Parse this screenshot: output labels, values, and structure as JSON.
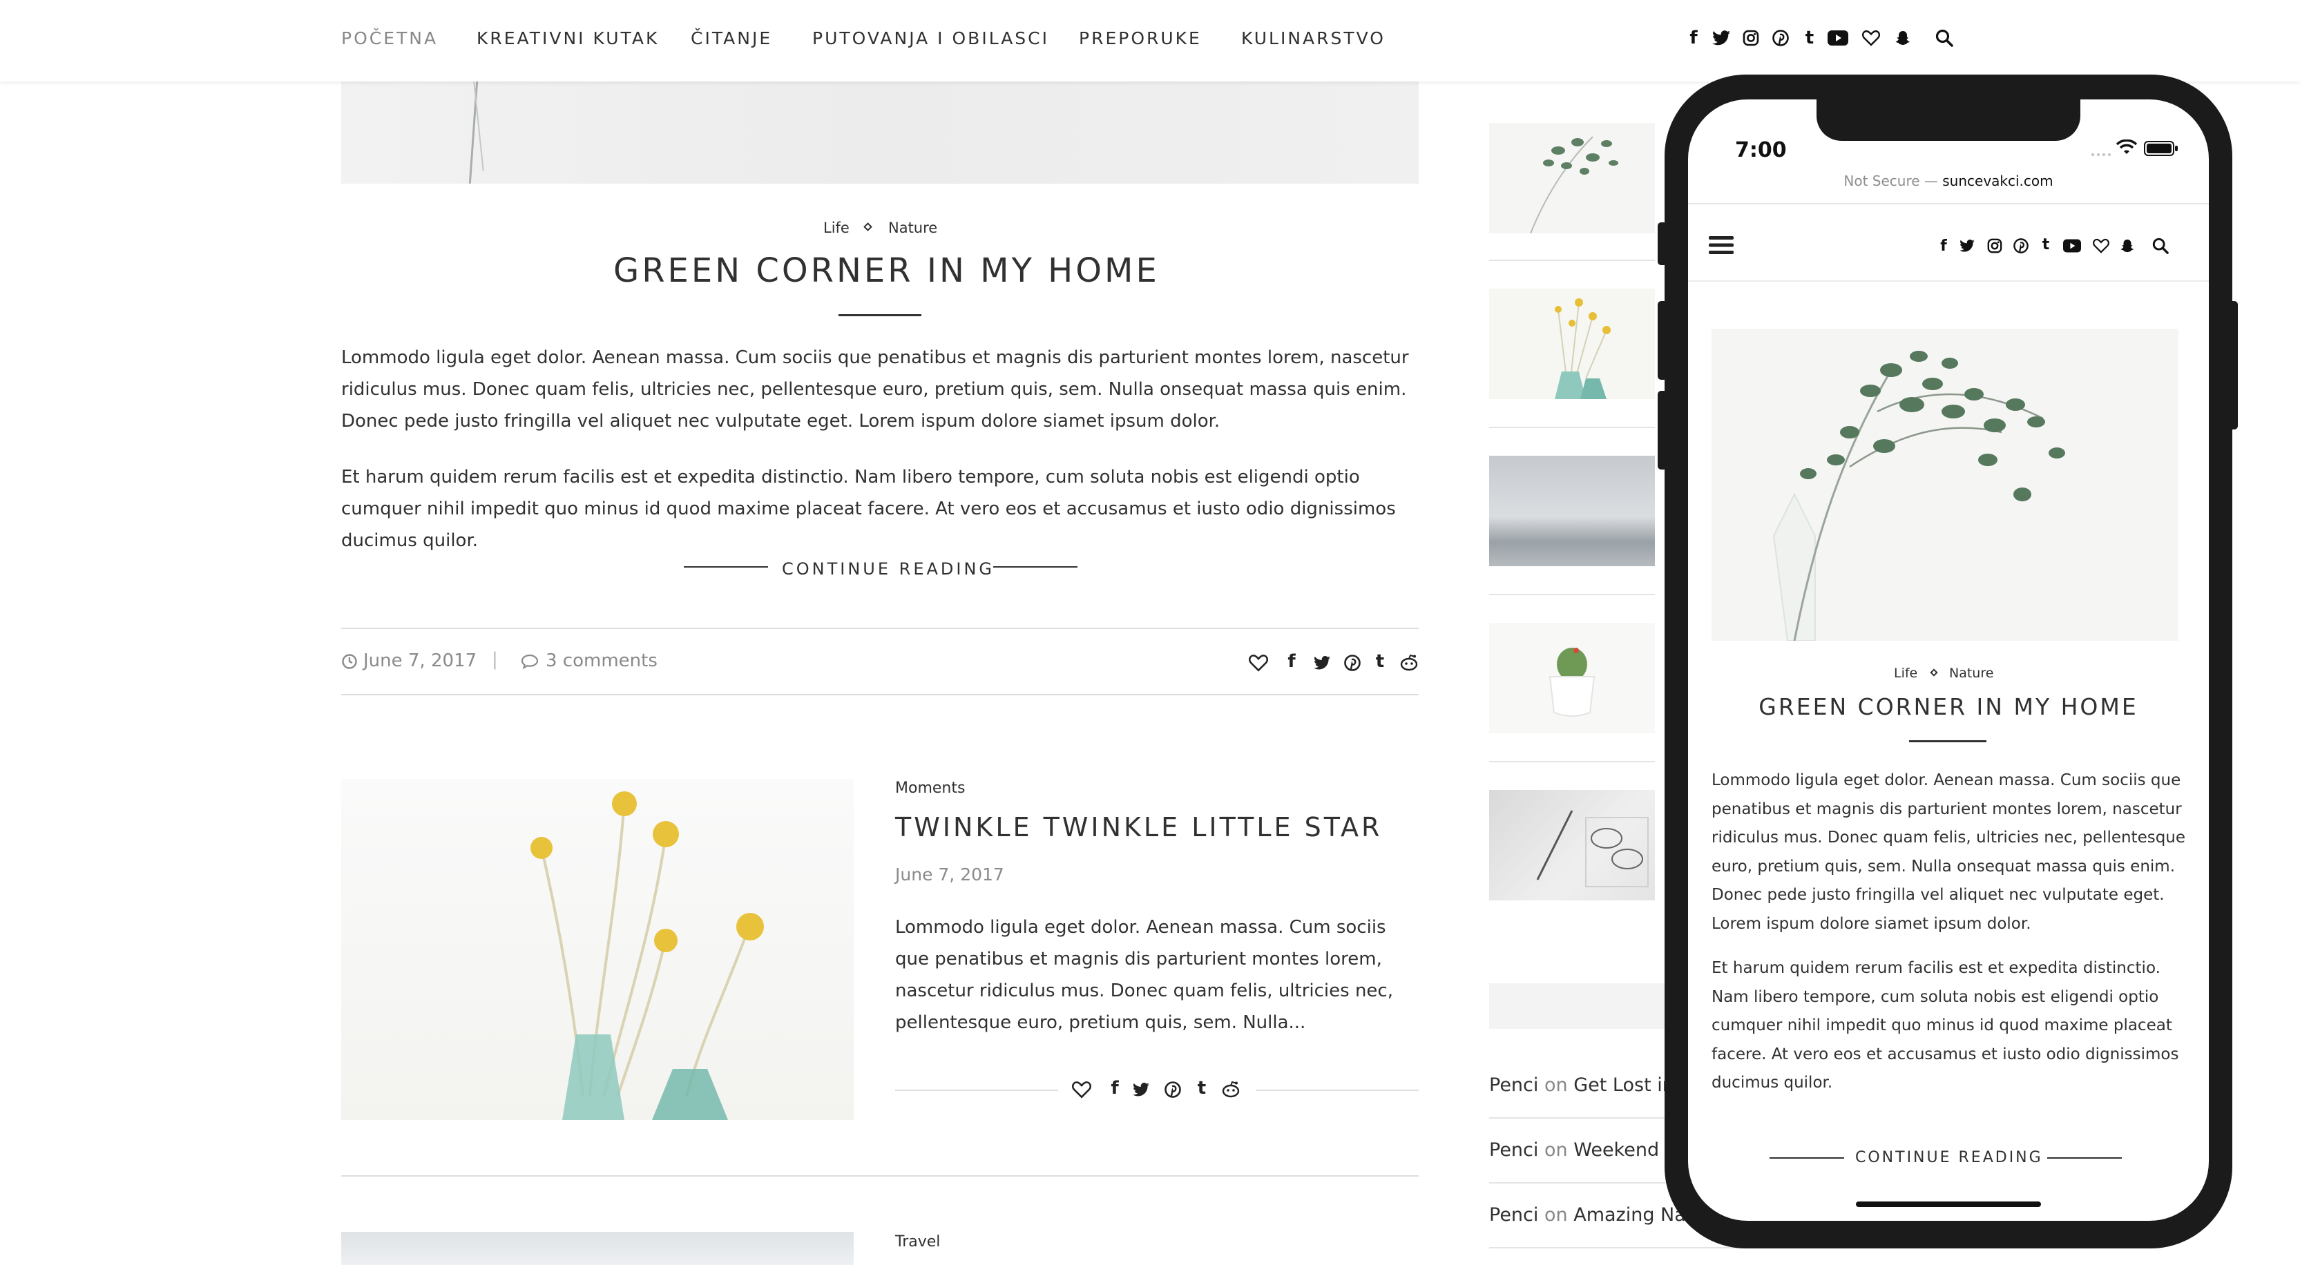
{
  "nav": {
    "items": [
      "POČETNA",
      "KREATIVNI KUTAK",
      "ČITANJE",
      "PUTOVANJA I OBILASCI",
      "PREPORUKE",
      "KULINARSTVO"
    ]
  },
  "social_icons": [
    "facebook-icon",
    "twitter-icon",
    "instagram-icon",
    "pinterest-icon",
    "tumblr-icon",
    "youtube-icon",
    "heart-icon",
    "snapchat-icon"
  ],
  "post1": {
    "categories": [
      "Life",
      "Nature"
    ],
    "title": "GREEN CORNER IN MY HOME",
    "paragraph1": "Lommodo ligula eget dolor. Aenean massa. Cum sociis que penatibus et magnis dis parturient montes lorem, nascetur ridiculus mus. Donec quam felis, ultricies nec, pellentesque euro, pretium quis, sem. Nulla onsequat massa quis enim. Donec pede justo fringilla vel aliquet nec vulputate eget. Lorem ispum dolore siamet ipsum dolor.",
    "paragraph2": "Et harum quidem rerum facilis est et expedita distinctio. Nam libero tempore, cum soluta nobis est eligendi optio cumquer nihil impedit quo minus id quod maxime placeat facere. At vero eos et accusamus et iusto odio dignissimos ducimus quilor.",
    "continue": "CONTINUE READING",
    "date": "June 7, 2017",
    "separator": "|",
    "comments": "3 comments"
  },
  "post2": {
    "category": "Moments",
    "title": "TWINKLE TWINKLE LITTLE STAR",
    "date": "June 7, 2017",
    "excerpt": "Lommodo ligula eget dolor. Aenean massa. Cum sociis que penatibus et magnis dis parturient montes lorem, nascetur ridiculus mus. Donec quam felis, ultricies nec, pellentesque euro, pretium quis, sem. Nulla..."
  },
  "post3": {
    "category": "Travel"
  },
  "sidebar": {
    "comments": [
      {
        "author": "Penci",
        "on": "on",
        "post": "Get Lost in t"
      },
      {
        "author": "Penci",
        "on": "on",
        "post": "Weekend Co"
      },
      {
        "author": "Penci",
        "on": "on",
        "post": "Amazing Natu"
      }
    ]
  },
  "phone": {
    "time": "7:00",
    "url_prefix": "Not Secure —",
    "url_domain": "suncevakci.com",
    "categories": [
      "Life",
      "Nature"
    ],
    "title": "GREEN CORNER IN MY HOME",
    "paragraph1": "Lommodo ligula eget dolor. Aenean massa. Cum sociis que penatibus et magnis dis parturient montes lorem, nascetur ridiculus mus. Donec quam felis, ultricies nec, pellentesque euro, pretium quis, sem. Nulla onsequat massa quis enim. Donec pede justo fringilla vel aliquet nec vulputate eget. Lorem ispum dolore siamet ipsum dolor.",
    "paragraph2": "Et harum quidem rerum facilis est et expedita distinctio. Nam libero tempore, cum soluta nobis est eligendi optio cumquer nihil impedit quo minus id quod maxime placeat facere. At vero eos et accusamus et iusto odio dignissimos ducimus quilor.",
    "continue": "CONTINUE READING"
  },
  "colors": {
    "text": "#313131",
    "muted": "#888888",
    "divider": "#dedede",
    "phone_frame": "#1b1b1b"
  }
}
